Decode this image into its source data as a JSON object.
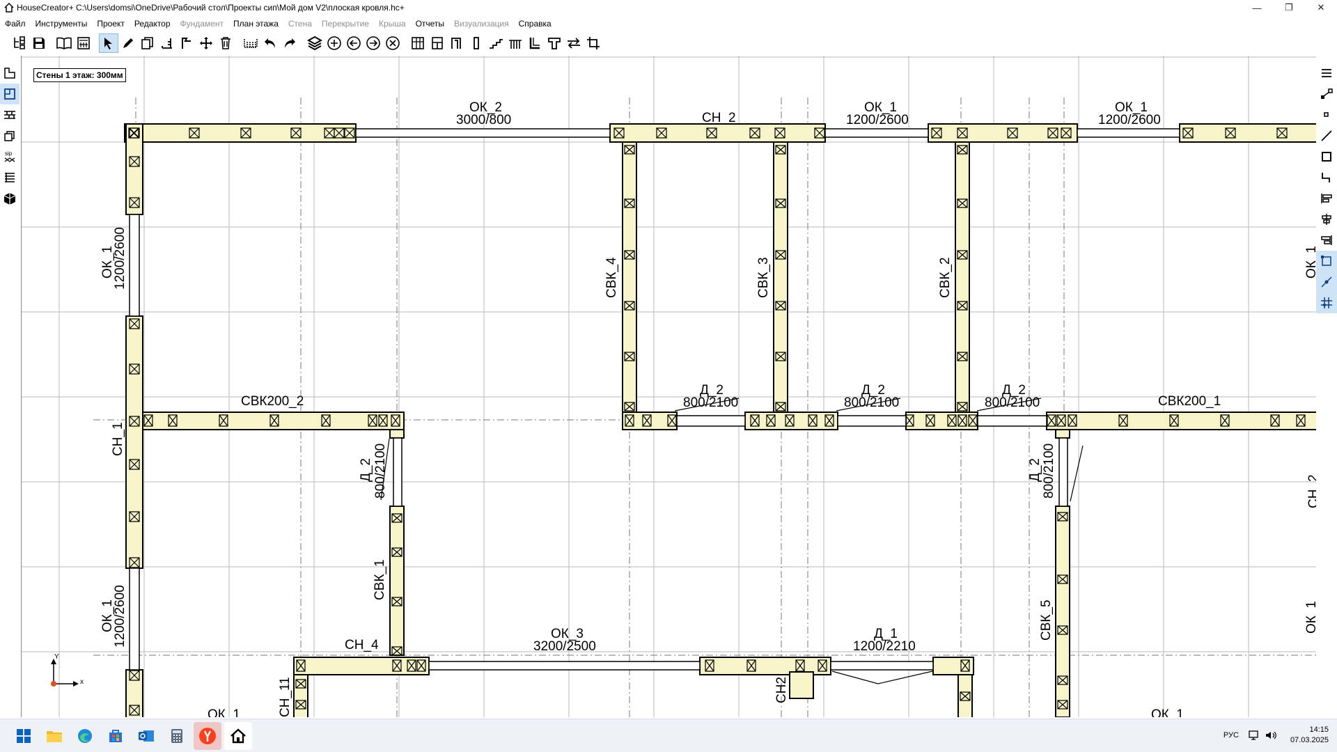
{
  "window": {
    "title": "HouseCreator+ C:\\Users\\domsi\\OneDrive\\Рабочий стол\\Проекты сип\\Мой дом V2\\плоская кровля.hc+",
    "minimize": "—",
    "maximize": "❐",
    "close": "✕"
  },
  "menu": [
    {
      "label": "Файл",
      "enabled": true
    },
    {
      "label": "Инструменты",
      "enabled": true
    },
    {
      "label": "Проект",
      "enabled": true
    },
    {
      "label": "Редактор",
      "enabled": true
    },
    {
      "label": "Фундамент",
      "enabled": false
    },
    {
      "label": "План этажа",
      "enabled": true
    },
    {
      "label": "Стена",
      "enabled": false
    },
    {
      "label": "Перекрытие",
      "enabled": false
    },
    {
      "label": "Крыша",
      "enabled": false
    },
    {
      "label": "Отчеты",
      "enabled": true
    },
    {
      "label": "Визуализация",
      "enabled": false
    },
    {
      "label": "Справка",
      "enabled": true
    }
  ],
  "canvas": {
    "status_label": "Стены 1 этаж: 300мм",
    "axis_x": "x",
    "axis_y": "Y",
    "labels": {
      "ok2_top": "ОК_2",
      "ok2_top_size": "3000/800",
      "ch2": "СН_2",
      "ok1_top_a": "ОК_1",
      "ok1_top_a_size": "1200/2600",
      "ok1_top_b": "ОК_1",
      "ok1_top_b_size": "1200/2600",
      "ok1_left_top": "ОК_1",
      "ok1_left_top_size": "1200/2600",
      "ok1_left_bot": "ОК_1",
      "ok1_left_bot_size": "1200/2600",
      "ok1_right_top": "ОК_1",
      "ok1_right_bot": "ОК_1",
      "ok1_bottom": "ОК_1",
      "ok1_bottom_left": "ОК_1",
      "svk4": "СВК_4",
      "svk3": "СВК_3",
      "svk2": "СВК_2",
      "svk1": "СВК_1",
      "svk5": "СВК_5",
      "svk200_2": "СВК200_2",
      "svk200_1": "СВК200_1",
      "ch1": "СН_1",
      "ch4": "СН_4",
      "ch11": "СН_11",
      "ch2_small": "СН2",
      "d2_a": "Д_2",
      "d2_a_size": "800/2100",
      "d2_b": "Д_2",
      "d2_b_size": "800/2100",
      "d2_c": "Д_2",
      "d2_c_size": "800/2100",
      "d2_left": "Д_2",
      "d2_left_size": "800/2100",
      "d2_right": "Д_2",
      "d2_right_size": "800/2100",
      "ok3": "ОК_3",
      "ok3_size": "3200/2500",
      "d1": "Д_1",
      "d1_size": "1200/2210",
      "ch_right": "СН_2"
    }
  },
  "taskbar": {
    "apps": [
      "start-icon",
      "explorer-icon",
      "edge-icon",
      "store-icon",
      "outlook-icon",
      "calculator-icon",
      "yandex-icon",
      "housecreator-icon"
    ],
    "lang": "РУС",
    "time": "14:15",
    "date": "07.03.2025"
  },
  "colors": {
    "wall_fill": "#f6f4c8",
    "grid": "#b9b9b9",
    "accent": "#0a62c4"
  }
}
